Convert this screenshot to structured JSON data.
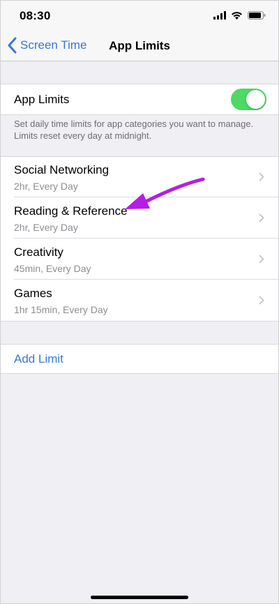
{
  "status_bar": {
    "time": "08:30",
    "icons": [
      "cellular-signal-icon",
      "wifi-icon",
      "battery-icon"
    ]
  },
  "nav": {
    "back_label": "Screen Time",
    "title": "App Limits"
  },
  "toggle_section": {
    "label": "App Limits",
    "enabled": true,
    "footer": "Set daily time limits for app categories you want to manage. Limits reset every day at midnight."
  },
  "limits": [
    {
      "title": "Social Networking",
      "subtitle": "2hr, Every Day"
    },
    {
      "title": "Reading & Reference",
      "subtitle": "2hr, Every Day"
    },
    {
      "title": "Creativity",
      "subtitle": "45min, Every Day"
    },
    {
      "title": "Games",
      "subtitle": "1hr 15min, Every Day"
    }
  ],
  "add_limit_label": "Add Limit",
  "colors": {
    "accent_blue": "#3478d6",
    "toggle_green": "#4cd964",
    "annotation_purple": "#b41ee6",
    "background": "#efeff4"
  }
}
